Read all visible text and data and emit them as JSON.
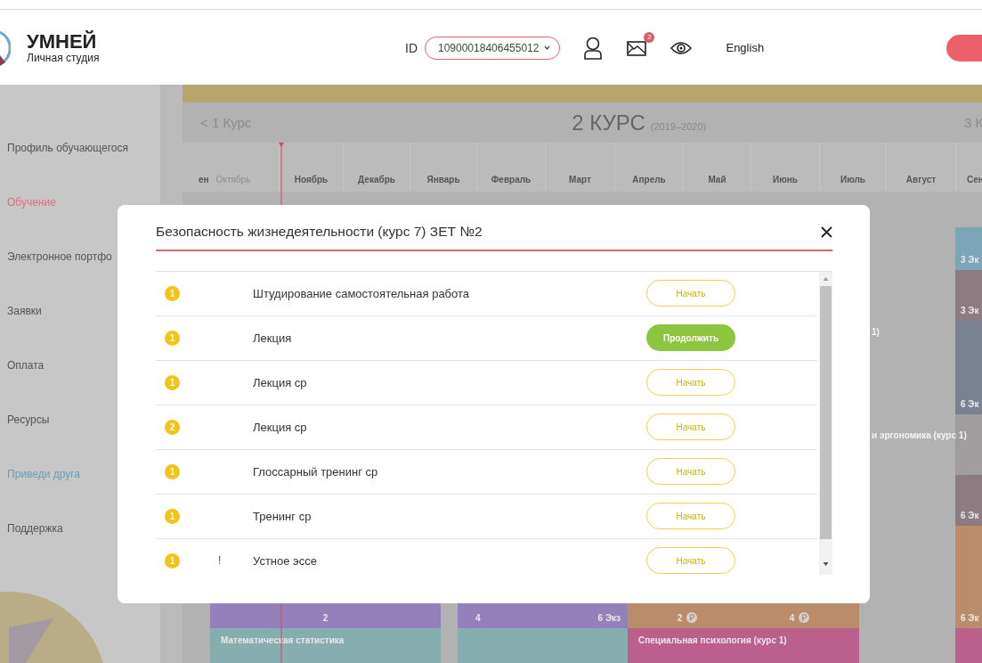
{
  "header": {
    "logo_title": "УМНЕЙ",
    "logo_subtitle": "Личная студия",
    "id_label": "ID",
    "id_value": "10900018406455012",
    "mail_badge": "2",
    "language": "English"
  },
  "sidebar": {
    "items": [
      {
        "label": "Профиль обучающегося",
        "selected": false,
        "kind": "item"
      },
      {
        "label": "Обучение",
        "selected": true,
        "kind": "item"
      },
      {
        "label": "Электронное портфо",
        "selected": false,
        "kind": "item"
      },
      {
        "label": "Заявки",
        "selected": false,
        "kind": "item"
      },
      {
        "label": "Оплата",
        "selected": false,
        "kind": "item"
      },
      {
        "label": "Ресурсы",
        "selected": false,
        "kind": "item"
      },
      {
        "label": "Приведи друга",
        "selected": false,
        "kind": "promo"
      },
      {
        "label": "Поддержка",
        "selected": false,
        "kind": "item"
      }
    ]
  },
  "course_nav": {
    "prev": "< 1 Курс",
    "current": "2 КУРС",
    "years": "(2019–2020)",
    "next": "3 К"
  },
  "months": [
    "ен",
    "Октябрь",
    "Ноябрь",
    "Декабрь",
    "Январь",
    "Февраль",
    "Март",
    "Апрель",
    "Май",
    "Июнь",
    "Июль",
    "Август",
    "Сен"
  ],
  "schedule_blocks": [
    {
      "color": "#7aa6b8",
      "texts": [
        "3 Эк"
      ],
      "kind": "plain"
    },
    {
      "color": "#8c7c82",
      "texts": [
        "3 Эк"
      ],
      "kind": "plain"
    },
    {
      "color": "#7a8292",
      "texts": [
        "6 Эк"
      ],
      "kind": "plain"
    },
    {
      "color": "#a19c9e",
      "kind": "plain"
    },
    {
      "color": "#8c7c82",
      "texts": [
        "6 Эк"
      ],
      "kind": "plain"
    },
    {
      "color": "#9480bb",
      "texts": [
        "2"
      ],
      "kind": "plain"
    },
    {
      "color": "#9480bb",
      "texts": [
        "4",
        "6 Экз"
      ],
      "kind": "plain"
    },
    {
      "color": "#bb8c6a",
      "texts": [
        "2",
        "4"
      ],
      "kind": "payment"
    },
    {
      "color": "#bb8c6a",
      "texts": [
        "6 Эк"
      ],
      "kind": "plain"
    },
    {
      "color": "#86aeae",
      "texts": [
        "Математическая статистика"
      ],
      "kind": "plain"
    },
    {
      "color": "#86aeae",
      "kind": "plain"
    },
    {
      "color": "#bb5f8c",
      "texts": [
        "Специальная психология (курс 1)"
      ],
      "kind": "plain"
    },
    {
      "color": "#bb5f8c",
      "kind": "plain"
    }
  ],
  "schedule_labels": [
    "1)",
    "и эргономика (курс 1)"
  ],
  "modal": {
    "title": "Безопасность жизнедеятельности (курс 7) ЗЕТ №2",
    "rows": [
      {
        "badge": "1",
        "title": "Штудирование самостоятельная работа",
        "action": {
          "label": "Начать",
          "kind": "start"
        }
      },
      {
        "badge": "1",
        "title": "Лекция",
        "action": {
          "label": "Продолжить",
          "kind": "continue"
        }
      },
      {
        "badge": "1",
        "title": "Лекция ср",
        "action": {
          "label": "Начать",
          "kind": "start"
        }
      },
      {
        "badge": "2",
        "title": "Лекция ср",
        "action": {
          "label": "Начать",
          "kind": "start"
        }
      },
      {
        "badge": "1",
        "title": "Глоссарный тренинг ср",
        "action": {
          "label": "Начать",
          "kind": "start"
        }
      },
      {
        "badge": "1",
        "title": "Тренинг ср",
        "action": {
          "label": "Начать",
          "kind": "start"
        }
      },
      {
        "badge": "1",
        "mark": "!",
        "title": "Устное эссе",
        "action": {
          "label": "Начать",
          "kind": "start"
        }
      }
    ]
  }
}
